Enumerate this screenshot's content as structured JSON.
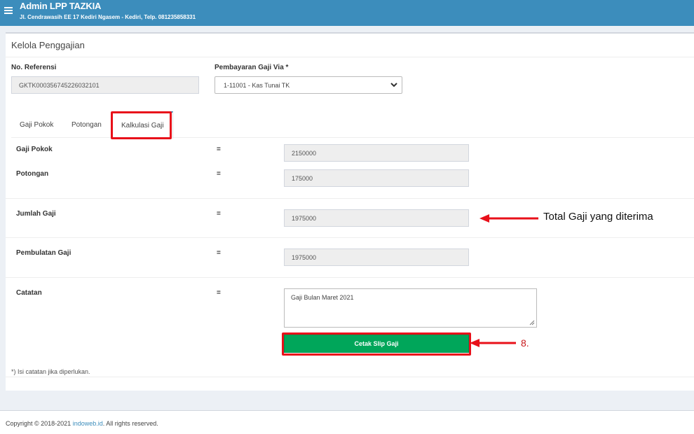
{
  "header": {
    "title": "Admin LPP TAZKIA",
    "subtitle": "Jl. Cendrawasih EE 17 Kediri Ngasem - Kediri, Telp. 081235858331"
  },
  "page": {
    "title": "Kelola Penggajian"
  },
  "form": {
    "ref_label": "No. Referensi",
    "ref_value": "GKTK000356745226032101",
    "via_label": "Pembayaran Gaji Via *",
    "via_value": "1-11001 - Kas Tunai TK"
  },
  "tabs": [
    {
      "label": "Gaji Pokok"
    },
    {
      "label": "Potongan"
    },
    {
      "label": "Kalkulasi Gaji"
    }
  ],
  "calc": {
    "eq": "=",
    "rows": [
      {
        "label": "Gaji Pokok",
        "value": "2150000"
      },
      {
        "label": "Potongan",
        "value": "175000"
      },
      {
        "label": "Jumlah Gaji",
        "value": "1975000"
      },
      {
        "label": "Pembulatan Gaji",
        "value": "1975000"
      }
    ],
    "note_label": "Catatan",
    "note_value": "Gaji Bulan Maret 2021",
    "print_button": "Cetak Slip Gaji",
    "footnote": "*) Isi catatan jika diperlukan."
  },
  "annotations": {
    "total_text": "Total Gaji yang diterima",
    "step": "8."
  },
  "footer": {
    "prefix": "Copyright © 2018-2021 ",
    "link": "indoweb.id",
    "suffix": ". All rights reserved."
  },
  "colors": {
    "header": "#3c8dbc",
    "button": "#00a65a",
    "highlight": "#e8101a"
  }
}
